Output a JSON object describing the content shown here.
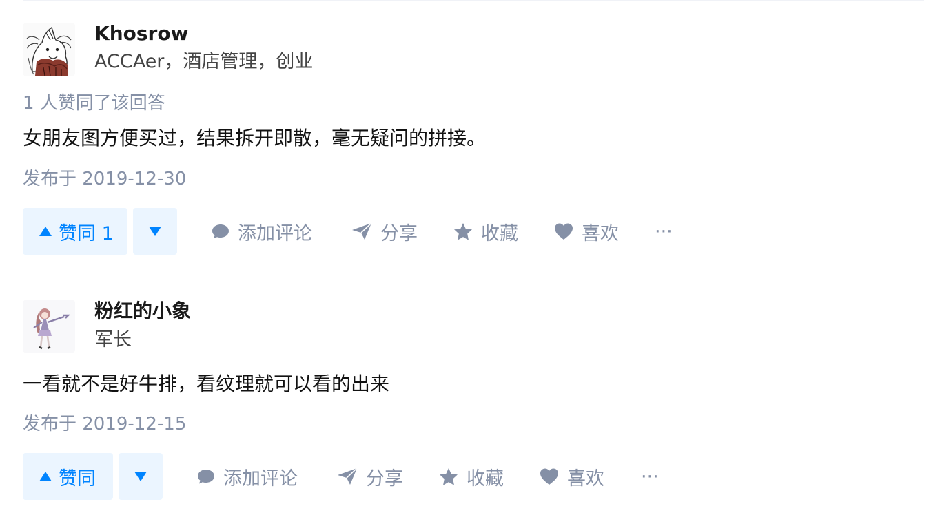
{
  "colors": {
    "accent": "#0084ff",
    "vote_bg": "#ebf5ff",
    "meta_gray": "#8590a6",
    "divider": "#ebeef5"
  },
  "answers": [
    {
      "author": {
        "name": "Khosrow",
        "bio": "ACCAer，酒店管理，创业",
        "avatar_icon": "sketch-unicorn-avatar"
      },
      "vote_summary": "1 人赞同了该回答",
      "content": "女朋友图方便买过，结果拆开即散，毫无疑问的拼接。",
      "published": "发布于 2019-12-30",
      "actions": {
        "upvote_label": "赞同 1",
        "comment_label": "添加评论",
        "share_label": "分享",
        "favorite_label": "收藏",
        "like_label": "喜欢",
        "more_label": "···"
      }
    },
    {
      "author": {
        "name": "粉红的小象",
        "bio": "军长",
        "avatar_icon": "anime-girl-avatar"
      },
      "content": "一看就不是好牛排，看纹理就可以看的出来",
      "published": "发布于 2019-12-15",
      "actions": {
        "upvote_label": "赞同",
        "comment_label": "添加评论",
        "share_label": "分享",
        "favorite_label": "收藏",
        "like_label": "喜欢",
        "more_label": "···"
      }
    }
  ]
}
